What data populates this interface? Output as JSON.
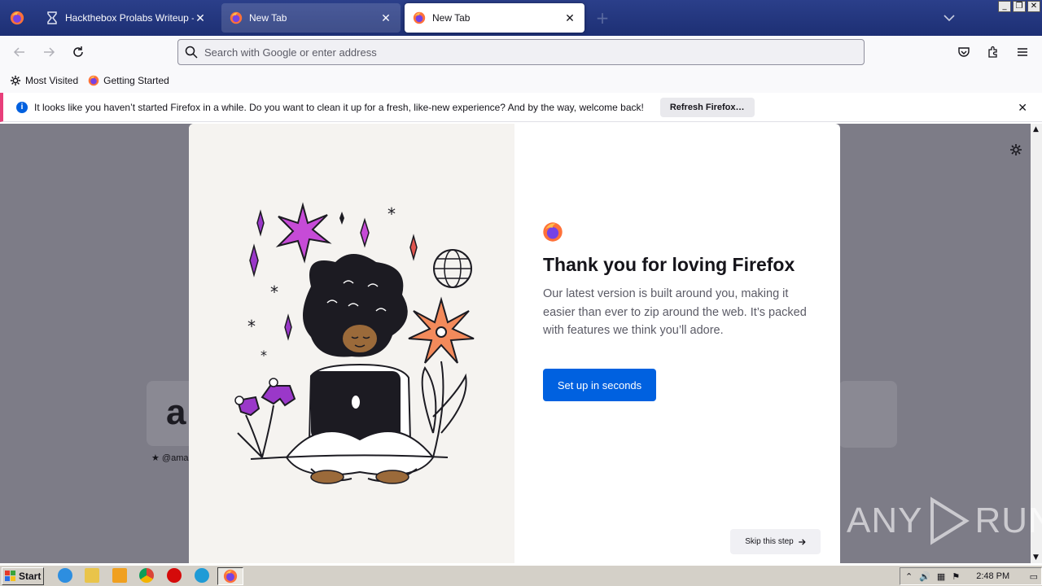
{
  "tabs": [
    {
      "title": "Hackthebox Prolabs Writeup - HTB",
      "active": false
    },
    {
      "title": "New Tab",
      "active": false
    },
    {
      "title": "New Tab",
      "active": true
    }
  ],
  "urlbar": {
    "placeholder": "Search with Google or enter address"
  },
  "bookmarks": [
    {
      "label": "Most Visited",
      "icon": "gear-icon"
    },
    {
      "label": "Getting Started",
      "icon": "firefox-icon"
    }
  ],
  "notice": {
    "message": "It looks like you haven’t started Firefox in a while. Do you want to clean it up for a fresh, like-new experience? And by the way, welcome back!",
    "button": "Refresh Firefox…"
  },
  "newtab": {
    "tile_label": "★ @ama",
    "tile_logo": "a"
  },
  "modal": {
    "title": "Thank you for loving Firefox",
    "subtitle": "Our latest version is built around you, making it easier than ever to zip around the web. It’s packed with features we think you’ll adore.",
    "primary_button": "Set up in seconds",
    "skip_button": "Skip this step"
  },
  "watermark": {
    "text_left": "ANY",
    "text_right": "RUN"
  },
  "taskbar": {
    "start_label": "Start",
    "clock": "2:48 PM"
  },
  "colors": {
    "primary": "#0061e0",
    "tabstrip": "#1d2f74",
    "notice_accent": "#e83f7a"
  }
}
